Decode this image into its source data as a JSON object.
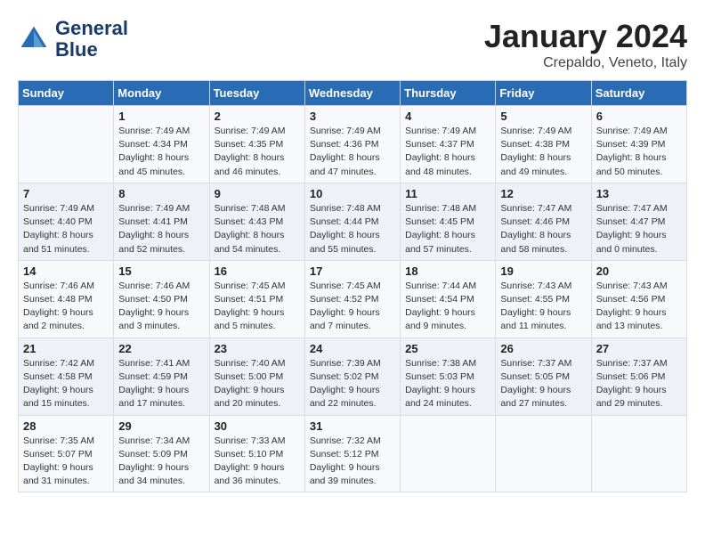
{
  "logo": {
    "line1": "General",
    "line2": "Blue"
  },
  "header": {
    "month": "January 2024",
    "location": "Crepaldo, Veneto, Italy"
  },
  "days_of_week": [
    "Sunday",
    "Monday",
    "Tuesday",
    "Wednesday",
    "Thursday",
    "Friday",
    "Saturday"
  ],
  "weeks": [
    [
      {
        "day": "",
        "sunrise": "",
        "sunset": "",
        "daylight": ""
      },
      {
        "day": "1",
        "sunrise": "Sunrise: 7:49 AM",
        "sunset": "Sunset: 4:34 PM",
        "daylight": "Daylight: 8 hours and 45 minutes."
      },
      {
        "day": "2",
        "sunrise": "Sunrise: 7:49 AM",
        "sunset": "Sunset: 4:35 PM",
        "daylight": "Daylight: 8 hours and 46 minutes."
      },
      {
        "day": "3",
        "sunrise": "Sunrise: 7:49 AM",
        "sunset": "Sunset: 4:36 PM",
        "daylight": "Daylight: 8 hours and 47 minutes."
      },
      {
        "day": "4",
        "sunrise": "Sunrise: 7:49 AM",
        "sunset": "Sunset: 4:37 PM",
        "daylight": "Daylight: 8 hours and 48 minutes."
      },
      {
        "day": "5",
        "sunrise": "Sunrise: 7:49 AM",
        "sunset": "Sunset: 4:38 PM",
        "daylight": "Daylight: 8 hours and 49 minutes."
      },
      {
        "day": "6",
        "sunrise": "Sunrise: 7:49 AM",
        "sunset": "Sunset: 4:39 PM",
        "daylight": "Daylight: 8 hours and 50 minutes."
      }
    ],
    [
      {
        "day": "7",
        "sunrise": "Sunrise: 7:49 AM",
        "sunset": "Sunset: 4:40 PM",
        "daylight": "Daylight: 8 hours and 51 minutes."
      },
      {
        "day": "8",
        "sunrise": "Sunrise: 7:49 AM",
        "sunset": "Sunset: 4:41 PM",
        "daylight": "Daylight: 8 hours and 52 minutes."
      },
      {
        "day": "9",
        "sunrise": "Sunrise: 7:48 AM",
        "sunset": "Sunset: 4:43 PM",
        "daylight": "Daylight: 8 hours and 54 minutes."
      },
      {
        "day": "10",
        "sunrise": "Sunrise: 7:48 AM",
        "sunset": "Sunset: 4:44 PM",
        "daylight": "Daylight: 8 hours and 55 minutes."
      },
      {
        "day": "11",
        "sunrise": "Sunrise: 7:48 AM",
        "sunset": "Sunset: 4:45 PM",
        "daylight": "Daylight: 8 hours and 57 minutes."
      },
      {
        "day": "12",
        "sunrise": "Sunrise: 7:47 AM",
        "sunset": "Sunset: 4:46 PM",
        "daylight": "Daylight: 8 hours and 58 minutes."
      },
      {
        "day": "13",
        "sunrise": "Sunrise: 7:47 AM",
        "sunset": "Sunset: 4:47 PM",
        "daylight": "Daylight: 9 hours and 0 minutes."
      }
    ],
    [
      {
        "day": "14",
        "sunrise": "Sunrise: 7:46 AM",
        "sunset": "Sunset: 4:48 PM",
        "daylight": "Daylight: 9 hours and 2 minutes."
      },
      {
        "day": "15",
        "sunrise": "Sunrise: 7:46 AM",
        "sunset": "Sunset: 4:50 PM",
        "daylight": "Daylight: 9 hours and 3 minutes."
      },
      {
        "day": "16",
        "sunrise": "Sunrise: 7:45 AM",
        "sunset": "Sunset: 4:51 PM",
        "daylight": "Daylight: 9 hours and 5 minutes."
      },
      {
        "day": "17",
        "sunrise": "Sunrise: 7:45 AM",
        "sunset": "Sunset: 4:52 PM",
        "daylight": "Daylight: 9 hours and 7 minutes."
      },
      {
        "day": "18",
        "sunrise": "Sunrise: 7:44 AM",
        "sunset": "Sunset: 4:54 PM",
        "daylight": "Daylight: 9 hours and 9 minutes."
      },
      {
        "day": "19",
        "sunrise": "Sunrise: 7:43 AM",
        "sunset": "Sunset: 4:55 PM",
        "daylight": "Daylight: 9 hours and 11 minutes."
      },
      {
        "day": "20",
        "sunrise": "Sunrise: 7:43 AM",
        "sunset": "Sunset: 4:56 PM",
        "daylight": "Daylight: 9 hours and 13 minutes."
      }
    ],
    [
      {
        "day": "21",
        "sunrise": "Sunrise: 7:42 AM",
        "sunset": "Sunset: 4:58 PM",
        "daylight": "Daylight: 9 hours and 15 minutes."
      },
      {
        "day": "22",
        "sunrise": "Sunrise: 7:41 AM",
        "sunset": "Sunset: 4:59 PM",
        "daylight": "Daylight: 9 hours and 17 minutes."
      },
      {
        "day": "23",
        "sunrise": "Sunrise: 7:40 AM",
        "sunset": "Sunset: 5:00 PM",
        "daylight": "Daylight: 9 hours and 20 minutes."
      },
      {
        "day": "24",
        "sunrise": "Sunrise: 7:39 AM",
        "sunset": "Sunset: 5:02 PM",
        "daylight": "Daylight: 9 hours and 22 minutes."
      },
      {
        "day": "25",
        "sunrise": "Sunrise: 7:38 AM",
        "sunset": "Sunset: 5:03 PM",
        "daylight": "Daylight: 9 hours and 24 minutes."
      },
      {
        "day": "26",
        "sunrise": "Sunrise: 7:37 AM",
        "sunset": "Sunset: 5:05 PM",
        "daylight": "Daylight: 9 hours and 27 minutes."
      },
      {
        "day": "27",
        "sunrise": "Sunrise: 7:37 AM",
        "sunset": "Sunset: 5:06 PM",
        "daylight": "Daylight: 9 hours and 29 minutes."
      }
    ],
    [
      {
        "day": "28",
        "sunrise": "Sunrise: 7:35 AM",
        "sunset": "Sunset: 5:07 PM",
        "daylight": "Daylight: 9 hours and 31 minutes."
      },
      {
        "day": "29",
        "sunrise": "Sunrise: 7:34 AM",
        "sunset": "Sunset: 5:09 PM",
        "daylight": "Daylight: 9 hours and 34 minutes."
      },
      {
        "day": "30",
        "sunrise": "Sunrise: 7:33 AM",
        "sunset": "Sunset: 5:10 PM",
        "daylight": "Daylight: 9 hours and 36 minutes."
      },
      {
        "day": "31",
        "sunrise": "Sunrise: 7:32 AM",
        "sunset": "Sunset: 5:12 PM",
        "daylight": "Daylight: 9 hours and 39 minutes."
      },
      {
        "day": "",
        "sunrise": "",
        "sunset": "",
        "daylight": ""
      },
      {
        "day": "",
        "sunrise": "",
        "sunset": "",
        "daylight": ""
      },
      {
        "day": "",
        "sunrise": "",
        "sunset": "",
        "daylight": ""
      }
    ]
  ]
}
